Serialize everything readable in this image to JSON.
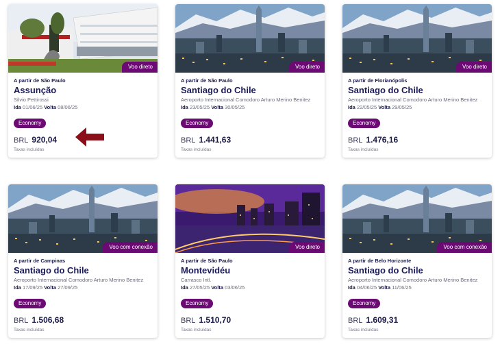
{
  "accent_color": "#6a0a72",
  "arrow_color": "#8b0f18",
  "cards": [
    {
      "tag": "Voo direto",
      "origin": "A partir de São Paulo",
      "city": "Assunção",
      "airport": "Silvio Pettirossi",
      "ida_label": "Ida",
      "ida": "01/06/25",
      "volta_label": "Volta",
      "volta": "08/06/25",
      "fare": "Economy",
      "currency": "BRL",
      "price": "920,04",
      "taxes": "Taxas incluídas",
      "image": "airport-building-photo"
    },
    {
      "tag": "Voo direto",
      "origin": "A partir de São Paulo",
      "city": "Santiago do Chile",
      "airport": "Aeroporto Internacional Comodoro Arturo Merino Benitez",
      "ida_label": "Ida",
      "ida": "23/05/25",
      "volta_label": "Volta",
      "volta": "30/05/25",
      "fare": "Economy",
      "currency": "BRL",
      "price": "1.441,63",
      "taxes": "Taxas incluídas",
      "image": "santiago-skyline-photo"
    },
    {
      "tag": "Voo direto",
      "origin": "A partir de Florianópolis",
      "city": "Santiago do Chile",
      "airport": "Aeroporto Internacional Comodoro Arturo Merino Benitez",
      "ida_label": "Ida",
      "ida": "22/05/25",
      "volta_label": "Volta",
      "volta": "29/05/25",
      "fare": "Economy",
      "currency": "BRL",
      "price": "1.476,16",
      "taxes": "Taxas incluídas",
      "image": "santiago-skyline-photo"
    },
    {
      "tag": "Voo com conexão",
      "origin": "A partir de Campinas",
      "city": "Santiago do Chile",
      "airport": "Aeroporto Internacional Comodoro Arturo Merino Benitez",
      "ida_label": "Ida",
      "ida": "17/09/25",
      "volta_label": "Volta",
      "volta": "27/09/25",
      "fare": "Economy",
      "currency": "BRL",
      "price": "1.506,68",
      "taxes": "Taxas incluídas",
      "image": "santiago-skyline-photo"
    },
    {
      "tag": "Voo direto",
      "origin": "A partir de São Paulo",
      "city": "Montevidéu",
      "airport": "Carrasco Intl.",
      "ida_label": "Ida",
      "ida": "27/05/25",
      "volta_label": "Volta",
      "volta": "03/06/25",
      "fare": "Economy",
      "currency": "BRL",
      "price": "1.510,70",
      "taxes": "Taxas incluídas",
      "image": "montevideo-night-photo"
    },
    {
      "tag": "Voo com conexão",
      "origin": "A partir de Belo Horizonte",
      "city": "Santiago do Chile",
      "airport": "Aeroporto Internacional Comodoro Arturo Merino Benitez",
      "ida_label": "Ida",
      "ida": "04/06/25",
      "volta_label": "Volta",
      "volta": "11/06/25",
      "fare": "Economy",
      "currency": "BRL",
      "price": "1.609,31",
      "taxes": "Taxas incluídas",
      "image": "santiago-skyline-photo"
    }
  ]
}
